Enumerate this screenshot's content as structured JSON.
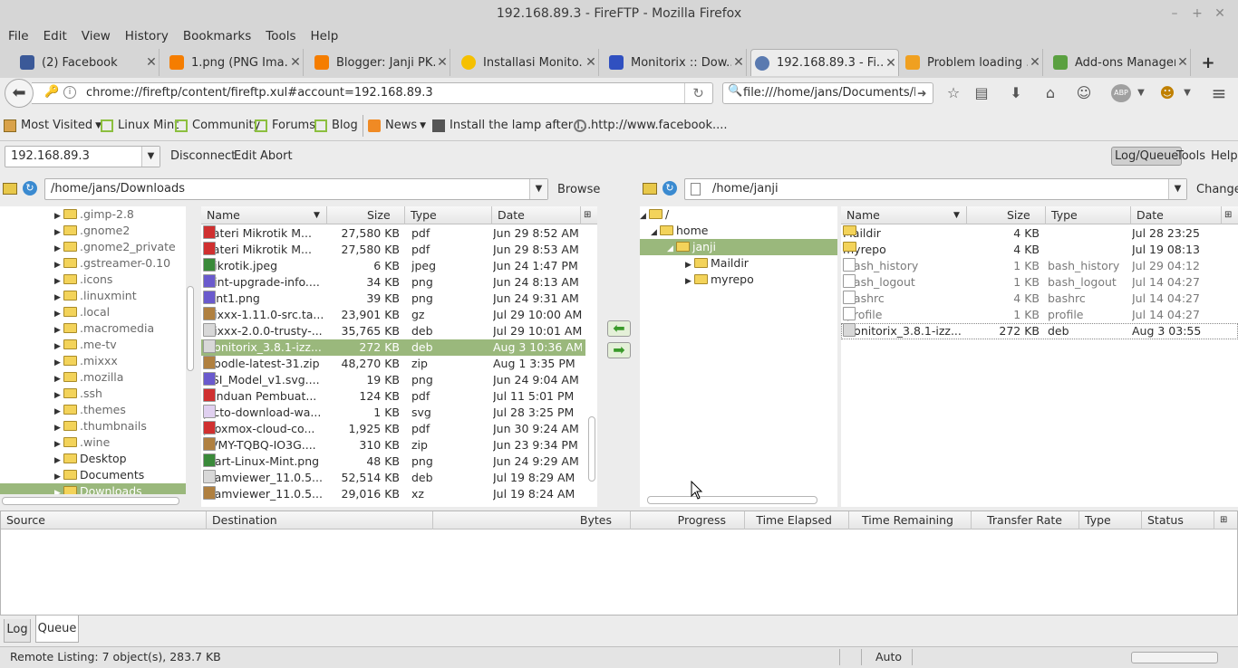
{
  "window": {
    "title": "192.168.89.3 - FireFTP - Mozilla Firefox"
  },
  "menu": [
    "File",
    "Edit",
    "View",
    "History",
    "Bookmarks",
    "Tools",
    "Help"
  ],
  "tabs": [
    {
      "label": "(2) Facebook",
      "color": "#3b5998"
    },
    {
      "label": "1.png (PNG Ima...",
      "color": "#f57d00"
    },
    {
      "label": "Blogger: Janji PK...",
      "color": "#f57d00"
    },
    {
      "label": "Installasi Monito...",
      "color": "#f5c000"
    },
    {
      "label": "Monitorix :: Dow...",
      "color": "#3050c0"
    },
    {
      "label": "192.168.89.3 - Fi...",
      "color": "#5a7ab0"
    },
    {
      "label": "Problem loading ...",
      "color": "#f0a020"
    },
    {
      "label": "Add-ons Manager",
      "color": "#5aa040"
    }
  ],
  "nav": {
    "url": "chrome://fireftp/content/fireftp.xul#account=192.168.89.3",
    "search": "file:///home/jans/Documents/Hotsp"
  },
  "bookmarks": [
    "Most Visited",
    "Linux Mint",
    "Community",
    "Forums",
    "Blog",
    "News",
    "Install the lamp after i...",
    "http://www.facebook...."
  ],
  "ftp": {
    "account": "192.168.89.3",
    "actions": [
      "Disconnect",
      "Edit",
      "Abort"
    ],
    "right_actions": [
      "Log/Queue",
      "Tools",
      "Help"
    ],
    "local_path": "/home/jans/Downloads",
    "browse": "Browse",
    "remote_path": "/home/janji",
    "change": "Change",
    "local_tree": [
      ".gimp-2.8",
      ".gnome2",
      ".gnome2_private",
      ".gstreamer-0.10",
      ".icons",
      ".linuxmint",
      ".local",
      ".macromedia",
      ".me-tv",
      ".mixxx",
      ".mozilla",
      ".ssh",
      ".themes",
      ".thumbnails",
      ".wine",
      "Desktop",
      "Documents",
      "Downloads"
    ],
    "cols": {
      "name": "Name",
      "size": "Size",
      "type": "Type",
      "date": "Date"
    },
    "local_files": [
      {
        "name": "Materi Mikrotik M...",
        "size": "27,580 KB",
        "type": "pdf",
        "date": "Jun 29 8:52 AM",
        "ic": "pdf"
      },
      {
        "name": "Materi Mikrotik M...",
        "size": "27,580 KB",
        "type": "pdf",
        "date": "Jun 29 8:53 AM",
        "ic": "pdf"
      },
      {
        "name": "mikrotik.jpeg",
        "size": "6 KB",
        "type": "jpeg",
        "date": "Jun 24 1:47 PM",
        "ic": "img"
      },
      {
        "name": "mint-upgrade-info....",
        "size": "34 KB",
        "type": "png",
        "date": "Jun 24 8:13 AM",
        "ic": "img2"
      },
      {
        "name": "Mint1.png",
        "size": "39 KB",
        "type": "png",
        "date": "Jun 24 9:31 AM",
        "ic": "img2"
      },
      {
        "name": "mixxx-1.11.0-src.ta...",
        "size": "23,901 KB",
        "type": "gz",
        "date": "Jul 29 10:00 AM",
        "ic": "arc"
      },
      {
        "name": "mixxx-2.0.0-trusty-...",
        "size": "35,765 KB",
        "type": "deb",
        "date": "Jul 29 10:01 AM",
        "ic": "deb"
      },
      {
        "name": "monitorix_3.8.1-izz...",
        "size": "272 KB",
        "type": "deb",
        "date": "Aug 3 10:36 AM",
        "ic": "deb"
      },
      {
        "name": "moodle-latest-31.zip",
        "size": "48,270 KB",
        "type": "zip",
        "date": "Aug 1 3:35 PM",
        "ic": "arc"
      },
      {
        "name": "OSI_Model_v1.svg....",
        "size": "19 KB",
        "type": "png",
        "date": "Jun 24 9:04 AM",
        "ic": "img2"
      },
      {
        "name": "Panduan Pembuat...",
        "size": "124 KB",
        "type": "pdf",
        "date": "Jul 11 5:01 PM",
        "ic": "pdf"
      },
      {
        "name": "picto-download-wa...",
        "size": "1 KB",
        "type": "svg",
        "date": "Jul 28 3:25 PM",
        "ic": "svg"
      },
      {
        "name": "proxmox-cloud-co...",
        "size": "1,925 KB",
        "type": "pdf",
        "date": "Jun 30 9:24 AM",
        "ic": "pdf"
      },
      {
        "name": "RVMY-TQBQ-IO3G....",
        "size": "310 KB",
        "type": "zip",
        "date": "Jun 23 9:34 PM",
        "ic": "arc"
      },
      {
        "name": "Start-Linux-Mint.png",
        "size": "48 KB",
        "type": "png",
        "date": "Jun 24 9:29 AM",
        "ic": "img"
      },
      {
        "name": "teamviewer_11.0.5...",
        "size": "52,514 KB",
        "type": "deb",
        "date": "Jul 19 8:29 AM",
        "ic": "deb"
      },
      {
        "name": "teamviewer_11.0.5...",
        "size": "29,016 KB",
        "type": "xz",
        "date": "Jul 19 8:24 AM",
        "ic": "arc"
      }
    ],
    "remote_tree": [
      "/",
      "home",
      "janji",
      "Maildir",
      "myrepo"
    ],
    "remote_files": [
      {
        "name": "Maildir",
        "size": "4 KB",
        "type": "",
        "date": "Jul 28 23:25",
        "ic": "folder"
      },
      {
        "name": "myrepo",
        "size": "4 KB",
        "type": "",
        "date": "Jul 19 08:13",
        "ic": "folder"
      },
      {
        "name": ".bash_history",
        "size": "1 KB",
        "type": "bash_history",
        "date": "Jul 29 04:12",
        "ic": "unk"
      },
      {
        "name": ".bash_logout",
        "size": "1 KB",
        "type": "bash_logout",
        "date": "Jul 14 04:27",
        "ic": "unk"
      },
      {
        "name": ".bashrc",
        "size": "4 KB",
        "type": "bashrc",
        "date": "Jul 14 04:27",
        "ic": "unk"
      },
      {
        "name": ".profile",
        "size": "1 KB",
        "type": "profile",
        "date": "Jul 14 04:27",
        "ic": "unk"
      },
      {
        "name": "monitorix_3.8.1-izz...",
        "size": "272 KB",
        "type": "deb",
        "date": "Aug 3 03:55",
        "ic": "deb"
      }
    ],
    "queue_cols": [
      "Source",
      "Destination",
      "Bytes",
      "Progress",
      "Time Elapsed",
      "Time Remaining",
      "Transfer Rate",
      "Type",
      "Status"
    ],
    "bottom_tabs": [
      "Log",
      "Queue"
    ],
    "status": "Remote Listing: 7 object(s), 283.7 KB",
    "mode": "Auto"
  }
}
